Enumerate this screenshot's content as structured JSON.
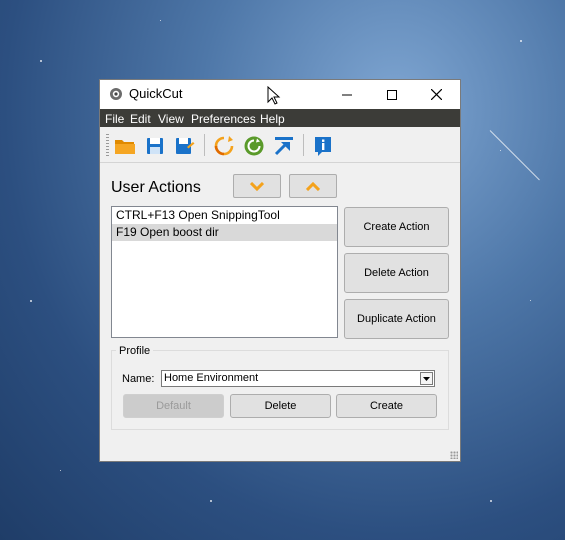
{
  "window": {
    "title": "QuickCut",
    "controls": {
      "minimize": "—",
      "maximize": "☐",
      "close": "✕"
    }
  },
  "menu": [
    "File",
    "Edit",
    "View",
    "Preferences",
    "Help"
  ],
  "toolbar_icons": [
    "open-folder-icon",
    "save-icon",
    "save-as-icon",
    "refresh-icon",
    "restart-icon",
    "export-icon",
    "info-icon"
  ],
  "main": {
    "heading": "User Actions",
    "actions": [
      {
        "label": "CTRL+F13 Open SnippingTool"
      },
      {
        "label": "F19 Open boost dir"
      }
    ],
    "selected_index": 1,
    "buttons": {
      "create_action": "Create Action",
      "delete_action": "Delete Action",
      "duplicate_action": "Duplicate Action"
    }
  },
  "profile": {
    "group_title": "Profile",
    "name_label": "Name:",
    "name_value": "Home Environment",
    "buttons": {
      "default": "Default",
      "delete": "Delete",
      "create": "Create"
    }
  },
  "colors": {
    "menubar": "#3c3c38",
    "accent_orange": "#f4a21c",
    "accent_blue": "#1a72c9",
    "accent_green": "#5a9a2a"
  }
}
